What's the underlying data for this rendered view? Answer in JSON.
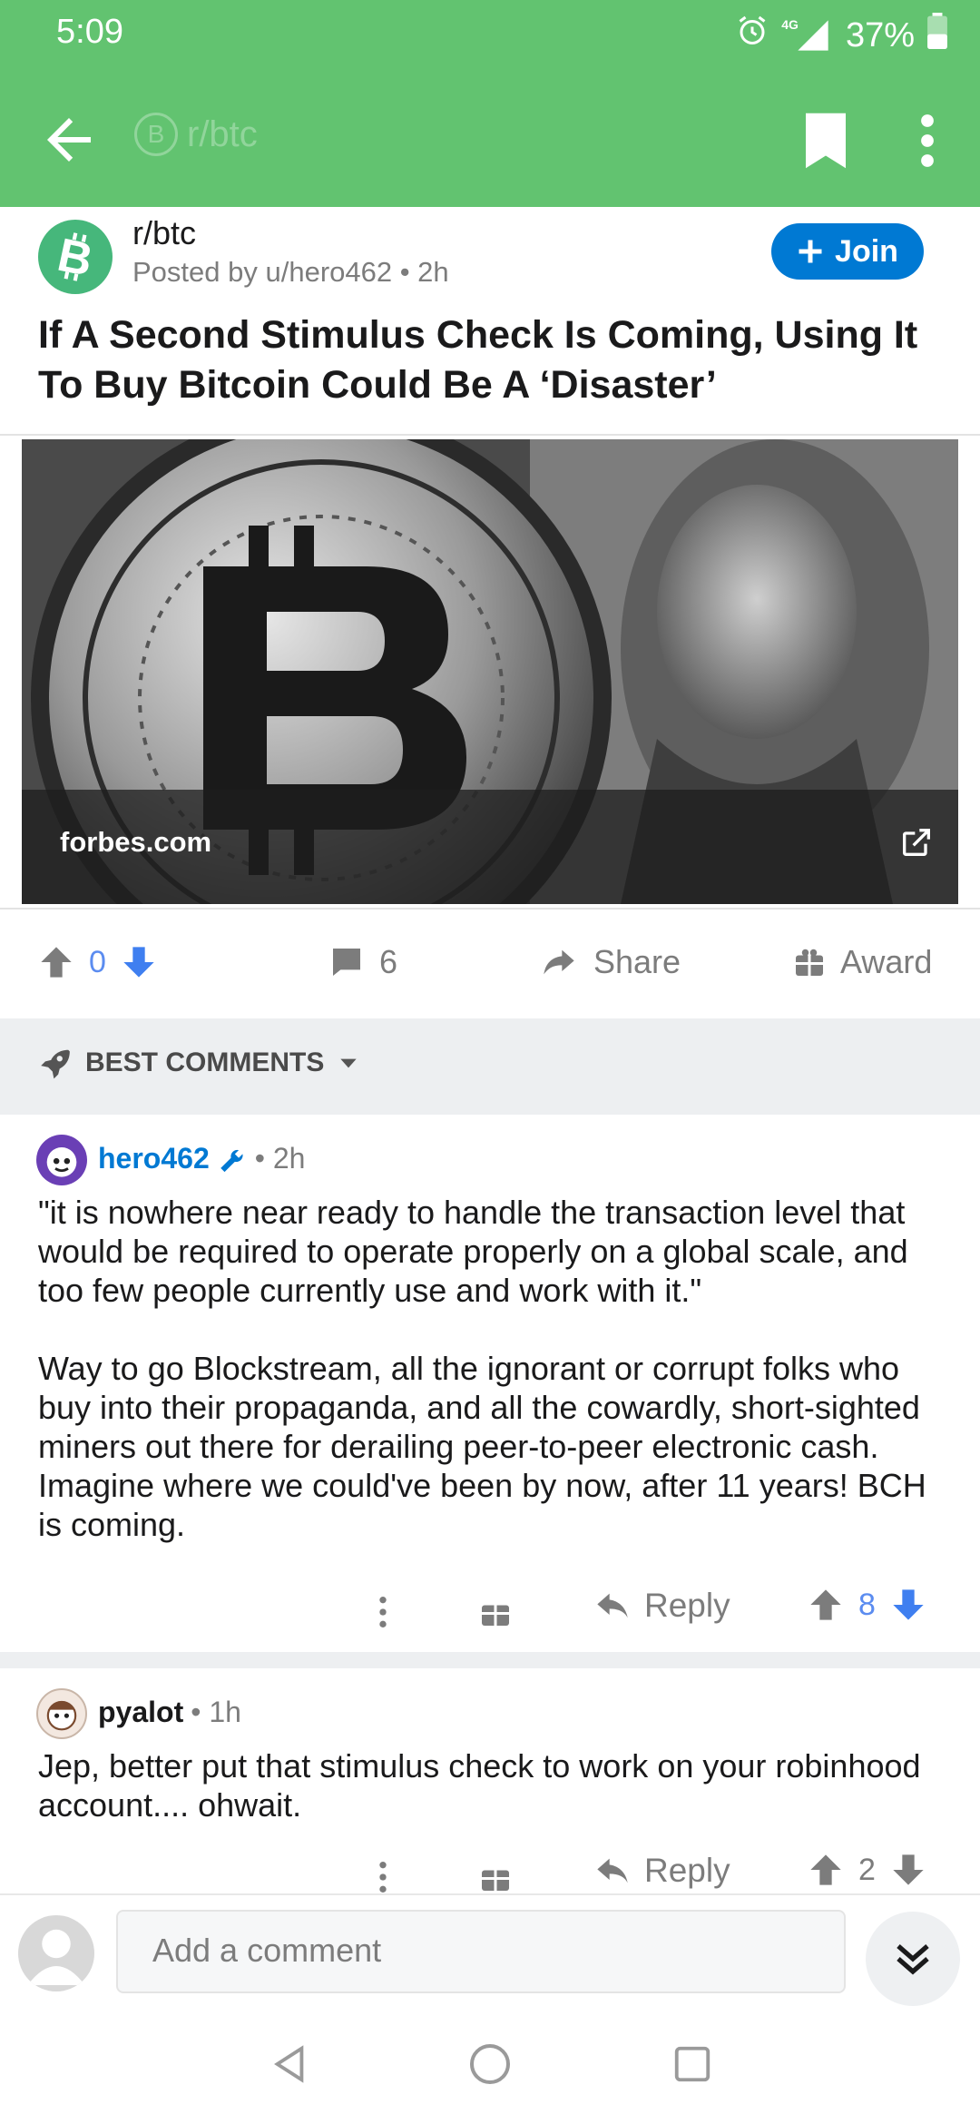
{
  "status_bar": {
    "time": "5:09",
    "network": "4G",
    "battery": "37%"
  },
  "app_bar": {
    "ghost_title": "r/btc",
    "ghost_icon_letter": "B"
  },
  "post": {
    "subreddit": "r/btc",
    "avatar_letter": "B",
    "posted_by": "Posted by u/hero462 • 2h",
    "join_label": "Join",
    "title": "If A Second Stimulus Check Is Coming, Using It To Buy Bitcoin Could Be A ‘Disaster’",
    "link_domain": "forbes.com",
    "score": "0",
    "comment_count": "6",
    "share_label": "Share",
    "award_label": "Award"
  },
  "sort": {
    "label": "BEST COMMENTS"
  },
  "comments": [
    {
      "user": "hero462",
      "age": "• 2h",
      "paragraphs": [
        "\"it is nowhere near ready to handle the transaction level that would be  required to operate properly on a global scale, and too few people  currently use and work with it.\"",
        "Way to  go Blockstream, all the ignorant or corrupt folks who buy into their propaganda, and all the cowardly, short-sighted miners out there for derailing peer-to-peer electronic cash. Imagine where we could've been by now, after 11 years!  BCH is coming."
      ],
      "reply_label": "Reply",
      "score": "8"
    },
    {
      "user": "pyalot",
      "age": "• 1h",
      "paragraphs": [
        "Jep, better put that stimulus check to work on your robinhood account.... ohwait."
      ],
      "reply_label": "Reply",
      "score": "2"
    }
  ],
  "composer": {
    "placeholder": "Add a comment"
  },
  "colors": {
    "brand_green": "#62c370",
    "upvote_blue": "#0079d3",
    "vote_active": "#5b8cf0",
    "icon_gray": "#7c7c7c"
  },
  "icons": [
    "back-arrow-icon",
    "bookmark-icon",
    "more-vertical-icon",
    "upvote-icon",
    "downvote-icon",
    "comment-icon",
    "share-icon",
    "award-icon",
    "rocket-icon",
    "mod-wrench-icon",
    "reply-icon",
    "external-link-icon",
    "chevron-double-down-icon",
    "nav-back-icon",
    "nav-home-icon",
    "nav-recents-icon"
  ]
}
